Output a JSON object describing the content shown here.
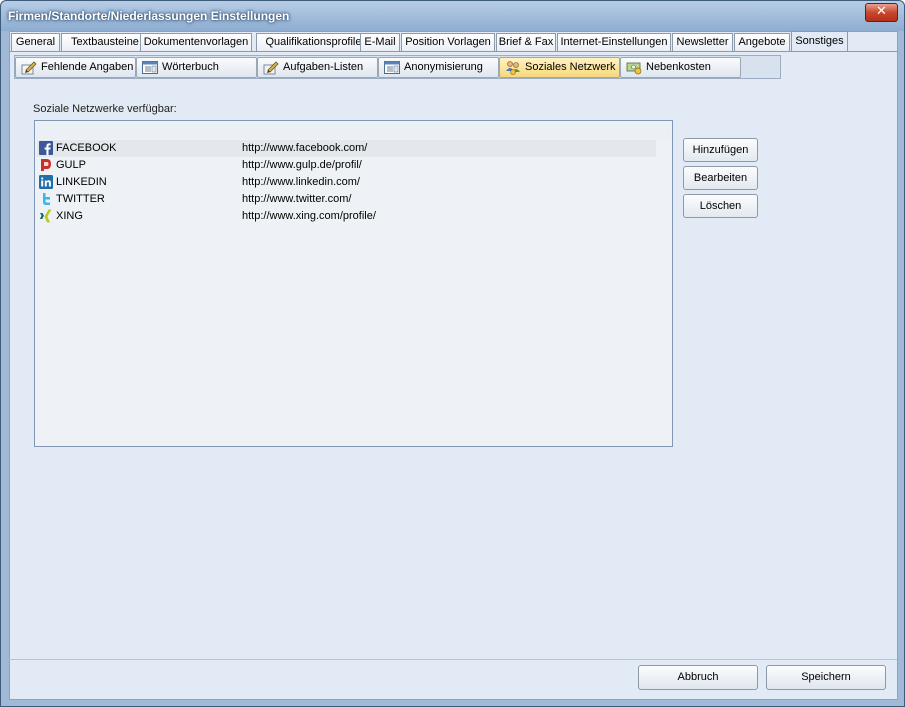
{
  "window": {
    "title": "Firmen/Standorte/Niederlassungen Einstellungen",
    "close_glyph": "✕"
  },
  "main_tabs": [
    {
      "label": "General"
    },
    {
      "label": "Textbausteine"
    },
    {
      "label": "Dokumentenvorlagen"
    },
    {
      "label": "Qualifikationsprofile"
    },
    {
      "label": "E-Mail"
    },
    {
      "label": "Position Vorlagen"
    },
    {
      "label": "Brief & Fax"
    },
    {
      "label": "Internet-Einstellungen"
    },
    {
      "label": "Newsletter"
    },
    {
      "label": "Angebote"
    },
    {
      "label": "Sonstiges",
      "active": true
    }
  ],
  "sub_tabs": [
    {
      "label": "Fehlende Angaben",
      "icon": "pen-paper-icon"
    },
    {
      "label": "Wörterbuch",
      "icon": "window-list-icon"
    },
    {
      "label": "Aufgaben-Listen",
      "icon": "pen-paper-icon"
    },
    {
      "label": "Anonymisierung",
      "icon": "window-list-icon"
    },
    {
      "label": "Soziales Netzwerk",
      "icon": "people-network-icon",
      "active": true
    },
    {
      "label": "Nebenkosten",
      "icon": "money-icon"
    }
  ],
  "networks_label": "Soziale Netzwerke verfügbar:",
  "networks": [
    {
      "name": "FACEBOOK",
      "url": "http://www.facebook.com/",
      "icon": "facebook-icon",
      "color": "#3b5998",
      "selected": true
    },
    {
      "name": "GULP",
      "url": "http://www.gulp.de/profil/",
      "icon": "gulp-icon",
      "color": "#c8302a"
    },
    {
      "name": "LINKEDIN",
      "url": "http://www.linkedin.com/",
      "icon": "linkedin-icon",
      "color": "#1f6ea8"
    },
    {
      "name": "TWITTER",
      "url": "http://www.twitter.com/",
      "icon": "twitter-icon",
      "color": "#38b9e8"
    },
    {
      "name": "XING",
      "url": "http://www.xing.com/profile/",
      "icon": "xing-icon",
      "color": "#0f6b68"
    }
  ],
  "buttons": {
    "add": "Hinzufügen",
    "edit": "Bearbeiten",
    "delete": "Löschen",
    "cancel": "Abbruch",
    "save": "Speichern"
  }
}
